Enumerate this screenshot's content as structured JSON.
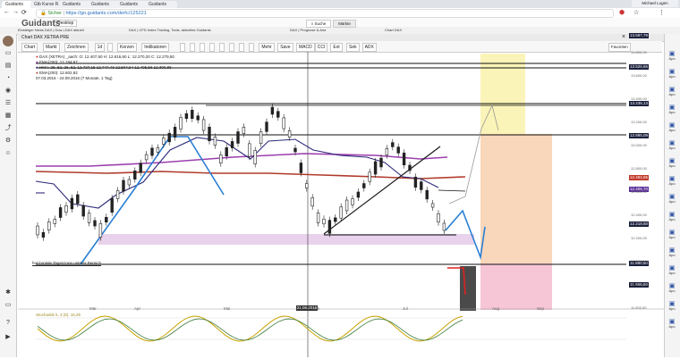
{
  "browser": {
    "tabs": [
      "Guidants",
      "Gib Kurse R...",
      "Guidants",
      "Guidants",
      "Guidants",
      "Guidants"
    ],
    "secure_label": "Sicher",
    "url": "https://go.guidants.com/de#c/125221",
    "profile_label": "Michael Lugen"
  },
  "bookmarks": [
    "Desktop"
  ],
  "app": {
    "logo": "Guidants",
    "tabs": [
      "Einsteiger News DAX | Dow | DAX aktuell",
      "DAX | CFD Index Trading, Tools, aktuelles Guidants",
      "DAX | Prognose & Analyse",
      "Chart DAX XETRA"
    ],
    "search_label": "Suche",
    "markets_label": "Märkte",
    "chart_tab_label": "Chart DAX XETRA PRE"
  },
  "toolbar": {
    "buttons": [
      "Chart",
      "Markt",
      "Zeichnen",
      "1d",
      "",
      "Kerzen",
      "Indikatoren",
      "",
      "",
      "",
      "",
      "",
      "",
      "",
      "",
      "Mehr",
      "Save",
      "MACD",
      "CCI",
      "Ext",
      "Sek",
      "ADX"
    ],
    "preset_label": "Favoriten"
  },
  "legend": {
    "line1": "DAX (XETRA) _aach: O: 12.407,50  H: 12.616,60  L: 12.270,20  C: 12.279,50",
    "line2": "EMA(200): 12.194,67",
    "line3": "HMA: 28, 52, 26, 52, 12.727,15 12.747,43 12.504,64 12.405,56 12.390,86",
    "line4": "EMA(200): 12.602,92",
    "line5": "07.03.2016 - 24.09.2016 (7 Monate, 1 Tag)"
  },
  "price_labels": [
    {
      "text": "13.587,79",
      "color": "#1a1f3a"
    },
    {
      "text": "13.525,66",
      "color": "#1a1f3a"
    },
    {
      "text": "13.236,13",
      "color": "#1a1f3a"
    },
    {
      "text": "12.895,09",
      "color": "#1a1f3a"
    },
    {
      "text": "12.482,65",
      "color": "#c23a2a"
    },
    {
      "text": "12.405,70",
      "color": "#5a2f9a"
    },
    {
      "text": "12.218,50",
      "color": "#1a1f3a"
    },
    {
      "text": "11.880,50",
      "color": "#1a1f3a"
    },
    {
      "text": "11.666,50",
      "color": "#1a1f3a"
    }
  ],
  "y_ticks": [
    "13.800,00",
    "13.600,00",
    "13.400,00",
    "13.200,00",
    "13.000,00",
    "12.800,00",
    "12.600,00",
    "12.400,00",
    "12.200,00",
    "12.000,00",
    "11.800,00",
    "11.600,00"
  ],
  "x_ticks": [
    "Mär",
    "Apr",
    "",
    "Mai",
    "",
    "Jun",
    "",
    "Jul",
    "",
    "Aug",
    "Sep"
  ],
  "crosshair_date": "21.06.2016",
  "annotations": {
    "support_label": "horizontale Tageszone unterer Bereich"
  },
  "oscillator": {
    "label": "Stochastik 5, 3 (5): 16,25",
    "levels": [
      "80,00",
      "20,00"
    ]
  },
  "right_dock": [
    "Apo",
    "Apo",
    "Apo",
    "Apo",
    "Apo",
    "Apo",
    "Apo",
    "Apo",
    "Apo",
    "Apo",
    "Apo",
    "Apo",
    "Apo",
    "Apo",
    "Apo",
    "Apo"
  ],
  "colors": {
    "candle": "#222222",
    "blue_line": "#2a7fd4",
    "purple_line": "#9b3fae",
    "navy_line": "#2d2a7a",
    "red_line": "#b03a2a",
    "zone_yellow": "#fbf4b8",
    "zone_orange": "#f9d7bb",
    "zone_pink": "#f6c6d6",
    "zone_lilac": "#e8d2ec"
  }
}
